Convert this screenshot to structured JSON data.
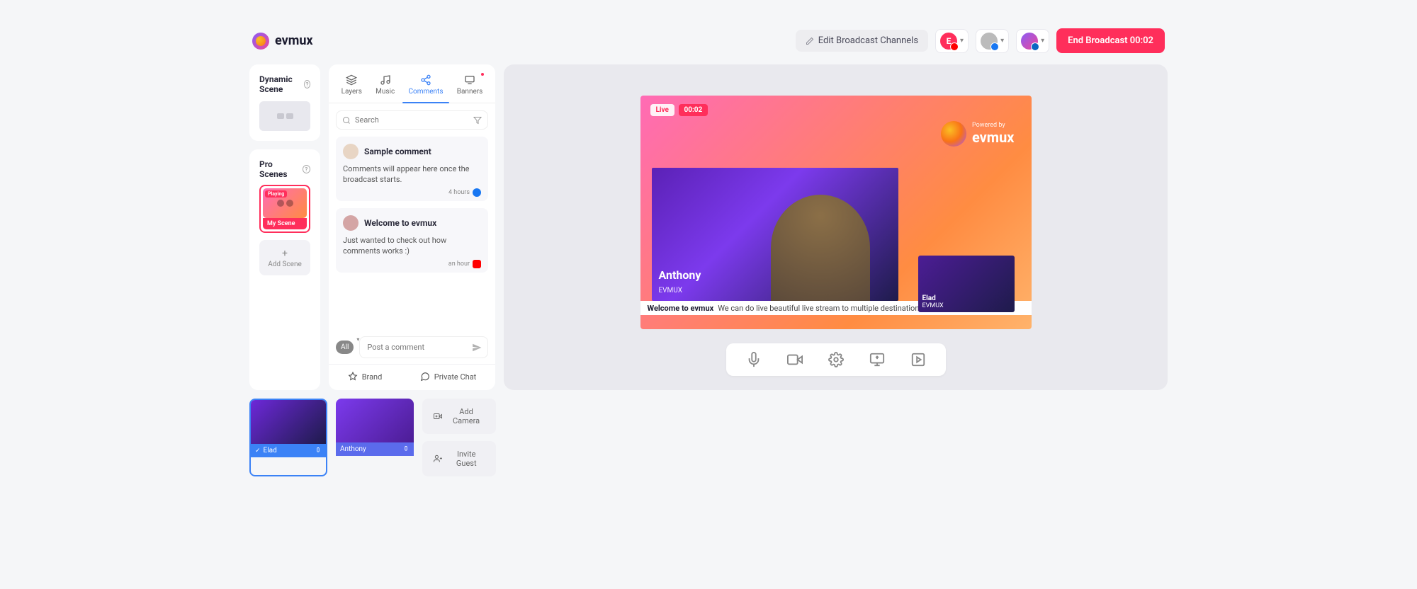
{
  "brand": "evmux",
  "header": {
    "edit_channels": "Edit Broadcast Channels",
    "end_broadcast": "End Broadcast 00:02",
    "channels": [
      {
        "avatar_bg": "#ff2e5b",
        "letter": "E",
        "badge": "#ff0000"
      },
      {
        "avatar_bg": "#888",
        "letter": "",
        "badge": "#1877f2"
      },
      {
        "avatar_bg": "linear-gradient(135deg,#8b5cf6,#ec4899)",
        "letter": "",
        "badge": "#0a66c2"
      }
    ]
  },
  "dynamic_scene": {
    "title": "Dynamic Scene"
  },
  "pro_scenes": {
    "title": "Pro Scenes",
    "playing": "Playing",
    "scene_name": "My Scene",
    "add_scene": "Add Scene"
  },
  "tabs": {
    "layers": "Layers",
    "music": "Music",
    "comments": "Comments",
    "banners": "Banners"
  },
  "search": {
    "placeholder": "Search"
  },
  "comments": [
    {
      "name": "Sample comment",
      "body": "Comments will appear here once the broadcast starts.",
      "time": "4 hours",
      "platform": "facebook"
    },
    {
      "name": "Welcome to evmux",
      "body": "Just wanted to check out how comments works :)",
      "time": "an hour",
      "platform": "youtube"
    }
  ],
  "compose": {
    "all": "All",
    "placeholder": "Post a comment"
  },
  "bottom": {
    "brand": "Brand",
    "private_chat": "Private Chat"
  },
  "stream": {
    "live": "Live",
    "timer": "00:02",
    "powered_by": "Powered by",
    "powered_brand": "evmux",
    "main_cam": {
      "name": "Anthony",
      "org": "EVMUX"
    },
    "pip_cam": {
      "name": "Elad",
      "org": "EVMUX"
    },
    "ticker_title": "Welcome to evmux",
    "ticker_body": "We can do live beautiful live stream to multiple destinations"
  },
  "cams": [
    {
      "name": "Elad",
      "active": true
    },
    {
      "name": "Anthony",
      "active": false
    }
  ],
  "side": {
    "add_camera": "Add Camera",
    "invite_guest": "Invite Guest"
  }
}
